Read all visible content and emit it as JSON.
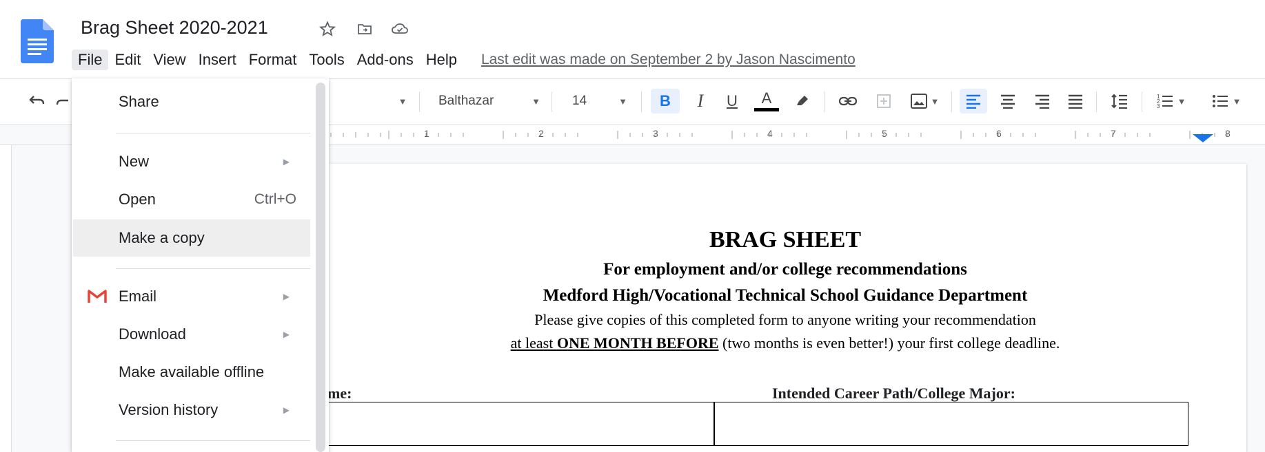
{
  "doc": {
    "title": "Brag Sheet 2020-2021",
    "last_edit": "Last edit was made on September 2 by Jason Nascimento"
  },
  "menubar": [
    "File",
    "Edit",
    "View",
    "Insert",
    "Format",
    "Tools",
    "Add-ons",
    "Help"
  ],
  "toolbar": {
    "font": "Balthazar",
    "font_size": "14",
    "bold": "B",
    "italic": "I",
    "underline": "U",
    "text_color": "A"
  },
  "ruler": [
    "1",
    "2",
    "3",
    "4",
    "5",
    "6",
    "7",
    "8"
  ],
  "file_menu": {
    "share": "Share",
    "new": "New",
    "open": "Open",
    "open_shortcut": "Ctrl+O",
    "make_copy": "Make a copy",
    "email": "Email",
    "download": "Download",
    "offline": "Make available offline",
    "version_history": "Version history"
  },
  "page": {
    "title": "BRAG SHEET",
    "subtitle1": "For employment and/or college recommendations",
    "subtitle2": "Medford High/Vocational Technical School Guidance Department",
    "line1": "Please give copies of this completed form to anyone writing your recommendation",
    "line2_a": "at least ",
    "line2_b": "ONE MONTH BEFORE",
    "line2_c": " (two months is even better!) your first college deadline.",
    "label_name": "ame:",
    "label_career": "Intended Career Path/College Major:"
  },
  "colors": {
    "accent": "#1a73e8",
    "doc_icon": "#4285f4",
    "gmail_red": "#ea4335"
  },
  "icons": [
    "docs-icon",
    "star-icon",
    "move-folder-icon",
    "cloud-status-icon",
    "undo-icon",
    "redo-icon",
    "link-icon",
    "comment-icon",
    "image-icon",
    "highlight-icon",
    "line-spacing-icon",
    "numbered-list-icon",
    "bulleted-list-icon",
    "gmail-icon",
    "indent-marker-icon"
  ]
}
